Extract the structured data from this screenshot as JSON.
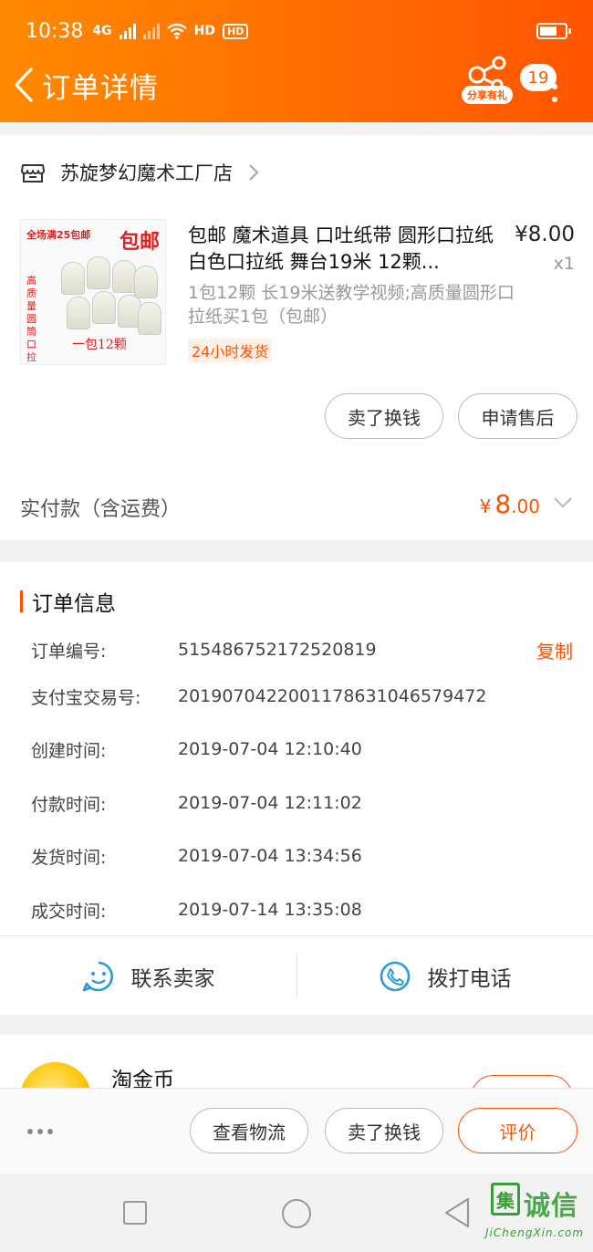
{
  "status_bar": {
    "time": "10:38",
    "network": "4G",
    "hd": "HD",
    "network2": "HD"
  },
  "header": {
    "title": "订单详情",
    "share_label": "分享有礼",
    "badge": "19"
  },
  "store": {
    "name": "苏旋梦幻魔术工厂店"
  },
  "product": {
    "image": {
      "top_text": "全场满25包邮",
      "right_text": "包邮",
      "side_text": "高质量圆筒口拉纸",
      "bottom_text": "一包12颗"
    },
    "title": "包邮 魔术道具 口吐纸带 圆形口拉纸 白色口拉纸 舞台19米 12颗...",
    "price": "¥8.00",
    "quantity": "x1",
    "sku": "1包12颗 长19米送教学视频;高质量圆形口拉纸买1包（包邮）",
    "tag": "24小时发货"
  },
  "item_actions": {
    "sell": "卖了换钱",
    "aftersale": "申请售后"
  },
  "payment": {
    "label": "实付款（含运费）",
    "currency": "¥",
    "integer": "8",
    "decimal": ".00"
  },
  "order_info": {
    "title": "订单信息",
    "copy_label": "复制",
    "rows": [
      {
        "label": "订单编号:",
        "value": "515486752172520819"
      },
      {
        "label": "支付宝交易号:",
        "value": "2019070422001178631046579472"
      },
      {
        "label": "创建时间:",
        "value": "2019-07-04 12:10:40"
      },
      {
        "label": "付款时间:",
        "value": "2019-07-04 12:11:02"
      },
      {
        "label": "发货时间:",
        "value": "2019-07-04 13:34:56"
      },
      {
        "label": "成交时间:",
        "value": "2019-07-14 13:35:08"
      }
    ]
  },
  "contact": {
    "seller": "联系卖家",
    "phone": "拨打电话"
  },
  "coin": {
    "title": "淘金币"
  },
  "bottom_actions": {
    "logistics": "查看物流",
    "sell": "卖了换钱",
    "review": "评价"
  },
  "watermark": {
    "text": "诚信",
    "box": "集",
    "url": "JiChengXin.com"
  },
  "colors": {
    "accent": "#ff5000",
    "header_start": "#ff8a00",
    "header_end": "#ff5500",
    "icon_blue": "#2a9ae0"
  }
}
